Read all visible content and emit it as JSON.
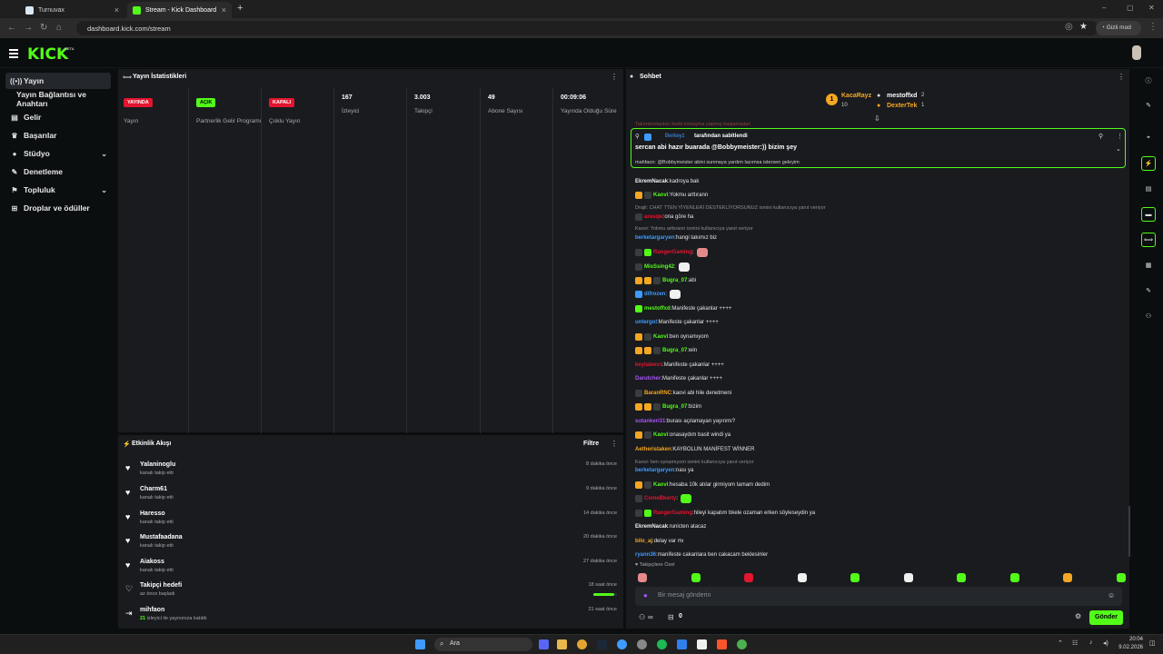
{
  "browser": {
    "tabs": [
      {
        "label": "Turnuvax",
        "close": "×"
      },
      {
        "label": "Stream - Kick Dashboard",
        "close": "×"
      }
    ],
    "new_tab": "+",
    "url": "dashboard.kick.com/stream",
    "incognito": "Gizli mod",
    "window_controls": [
      "–",
      "▢",
      "✕"
    ]
  },
  "header": {
    "logo": "KICK",
    "beta": "BETA",
    "menu_icon": "hamburger-icon"
  },
  "sidebar": {
    "items": [
      {
        "label": "Yayın",
        "icon": "stream-icon",
        "active": true
      },
      {
        "label": "Yayın Bağlantısı ve Anahtarı",
        "icon": "",
        "active": false
      },
      {
        "label": "Gelir",
        "icon": "revenue-icon"
      },
      {
        "label": "Başarılar",
        "icon": "trophy-icon"
      },
      {
        "label": "Stüdyo",
        "icon": "studio-icon",
        "chevron": true
      },
      {
        "label": "Denetleme",
        "icon": "wrench-icon"
      },
      {
        "label": "Topluluk",
        "icon": "community-icon",
        "chevron": true
      },
      {
        "label": "Droplar ve ödüller",
        "icon": "gift-icon"
      }
    ]
  },
  "stats": {
    "title": "Yayın İstatistikleri",
    "items": [
      {
        "badge": "YAYINDA",
        "badge_color": "#e3152f",
        "label": "Yayın"
      },
      {
        "badge": "AÇIK",
        "badge_color": "#53fc18",
        "label": "Partnerlik Gelir Programı"
      },
      {
        "badge": "KAPALI",
        "badge_color": "#e3152f",
        "label": "Çoklu Yayın"
      },
      {
        "value": "167",
        "label": "İzleyici"
      },
      {
        "value": "3.003",
        "label": "Takipçi"
      },
      {
        "value": "49",
        "label": "Abone Sayısı"
      },
      {
        "value": "00:09:06",
        "label": "Yayında Olduğu Süre"
      }
    ]
  },
  "activity": {
    "title": "Etkinlik Akışı",
    "filter": "Filtre",
    "items": [
      {
        "name": "Yalaninoglu",
        "sub": "kanalı takip etti",
        "time": "8 dakika önce"
      },
      {
        "name": "Charm61",
        "sub": "kanalı takip etti",
        "time": "9 dakika önce"
      },
      {
        "name": "Haresso",
        "sub": "kanalı takip etti",
        "time": "14 dakika önce"
      },
      {
        "name": "Mustafaadana",
        "sub": "kanalı takip etti",
        "time": "20 dakika önce"
      },
      {
        "name": "Aiakoss",
        "sub": "kanalı takip etti",
        "time": "27 dakika önce"
      },
      {
        "name": "Takipçi hedefi",
        "sub": "az önce başladı",
        "time": "18 saat önce",
        "progress": 0.9
      },
      {
        "name": "mihfaon",
        "sub_count": "21",
        "sub": "izleyici ile yayınınıza katıldı",
        "time": "21 saat önce"
      }
    ]
  },
  "chat": {
    "title": "Sohbet",
    "leaderboard": [
      {
        "name": "KacaRayz",
        "count": "10",
        "color": "#f5a623"
      },
      {
        "name": "mestoffxd",
        "count": "2",
        "color": "#ffffff"
      },
      {
        "name": "DexterTek",
        "count": "1",
        "color": "#f5a623"
      }
    ],
    "pinned": {
      "by": "Berkeyz",
      "action": "tarafından sabitlendi",
      "text": "sercan abi hazır buarada @Bobbymeister:)) bizim şey",
      "above": "Takımkontanları berbi konuşma yapmış başlamadan",
      "below": "mahfaon: @Bobbymeister abini sunmaya yardım lazımsa istersen geleyim"
    },
    "messages": [
      {
        "user": "EkremNacak",
        "color": "#f0f0f0",
        "text": "kadroya bak"
      },
      {
        "user": "Kaovi",
        "color": "#53fc18",
        "text": "Yokmu arttırann",
        "badges": [
          "#f5a623",
          "#3a3d40"
        ]
      },
      {
        "reply": "Drajil: CHAT TTEN YİYENLERİ DESTEKLİYORSUNUZ ismini kullanıcıya yanıt veriyor"
      },
      {
        "user": "arasqw",
        "color": "#e3152f",
        "text": "ona göre ha",
        "badges": [
          "#3a3d40"
        ]
      },
      {
        "reply": "Kaovi: Yokmu arttırann ismini kullanıcıya yanıt veriyor"
      },
      {
        "user": "berketargaryen",
        "color": "#3f9bff",
        "text": "hangi takımız biz"
      },
      {
        "user": "RangerGaming",
        "color": "#e3152f",
        "text": "",
        "badges": [
          "#3a3d40",
          "#53fc18"
        ],
        "emote": "#e58a8a"
      },
      {
        "user": "MisSsing42",
        "color": "#53fc18",
        "text": "",
        "badges": [
          "#3a3d40"
        ],
        "emote": "#f0f0f0"
      },
      {
        "user": "Bugra_07",
        "color": "#53fc18",
        "text": "abi",
        "badges": [
          "#f5a623",
          "#f5a623",
          "#3a3d40"
        ]
      },
      {
        "user": "difrozen",
        "color": "#3f9bff",
        "text": "",
        "badges": [
          "#3f9bff"
        ],
        "emote": "#f0f0f0"
      },
      {
        "user": "mestoffxd",
        "color": "#53fc18",
        "text": "Manifeste çakanlar ++++",
        "badges": [
          "#53fc18"
        ]
      },
      {
        "user": "untergol",
        "color": "#3f9bff",
        "text": "Manifeste çakanlar ++++"
      },
      {
        "user": "Kaovi",
        "color": "#53fc18",
        "text": "ben oynamıyom",
        "badges": [
          "#f5a623",
          "#3a3d40"
        ]
      },
      {
        "user": "Bugra_07",
        "color": "#53fc18",
        "text": "win",
        "badges": [
          "#f5a623",
          "#f5a623",
          "#3a3d40"
        ]
      },
      {
        "user": "keylaleevs",
        "color": "#e3152f",
        "text": "Manifeste çakanlar ++++"
      },
      {
        "user": "Darutcher",
        "color": "#a855f7",
        "text": "Manifeste çakanlar ++++"
      },
      {
        "user": "BaranRNC",
        "color": "#f5a623",
        "text": "kaovi abi hile denetmeni",
        "badges": [
          "#3a3d40"
        ]
      },
      {
        "user": "Bugra_07",
        "color": "#53fc18",
        "text": "bizim",
        "badges": [
          "#f5a623",
          "#f5a623",
          "#3a3d40"
        ]
      },
      {
        "user": "sutankeri31",
        "color": "#a855f7",
        "text": "burası açılamayan yayınmı?"
      },
      {
        "user": "Kaovi",
        "color": "#53fc18",
        "text": "onasaydım basit windi ya",
        "badges": [
          "#f5a623",
          "#3a3d40"
        ]
      },
      {
        "user": "Aetheristaken",
        "color": "#f5a623",
        "text": "KAYBOLUN MANİFEST WİNNER"
      },
      {
        "reply": "Kaovi: ben oynamıyom ismini kullanıcıya yanıt veriyor"
      },
      {
        "user": "berketargaryen",
        "color": "#3f9bff",
        "text": "nası ya"
      },
      {
        "user": "Kaovi",
        "color": "#53fc18",
        "text": "hesaba 10k atılar girmiyom tamam dedim",
        "badges": [
          "#f5a623",
          "#3a3d40"
        ]
      },
      {
        "user": "ComeBkerty",
        "color": "#e3152f",
        "text": "",
        "badges": [
          "#3a3d40"
        ],
        "emote": "#53fc18"
      },
      {
        "user": "RangerGaming",
        "color": "#e3152f",
        "text": "hileyi kapatım bkele ozaman erken söyleseydin ya",
        "badges": [
          "#3a3d40",
          "#53fc18"
        ]
      },
      {
        "user": "EkremNacak",
        "color": "#f0f0f0",
        "text": "runicten atacaz"
      },
      {
        "user": "bilo_aj",
        "color": "#f5a623",
        "text": "delay var mı"
      },
      {
        "user": "ryann36",
        "color": "#3f9bff",
        "text": "manifeste cakanlara ben cakacam beklesinler"
      }
    ],
    "followers_only": "Takipçilere Özel",
    "emote_colors": [
      "#e58a8a",
      "#53fc18",
      "#e3152f",
      "#f0f0f0",
      "#53fc18",
      "#f0f0f0",
      "#53fc18",
      "#53fc18",
      "#f5a623",
      "#53fc18"
    ],
    "input_placeholder": "Bir mesaj gönderin",
    "viewers_icon": "∞",
    "points": "0",
    "send": "Gönder"
  },
  "taskbar": {
    "search": "Ara",
    "time": "20:04",
    "date": "9.02.2026"
  }
}
